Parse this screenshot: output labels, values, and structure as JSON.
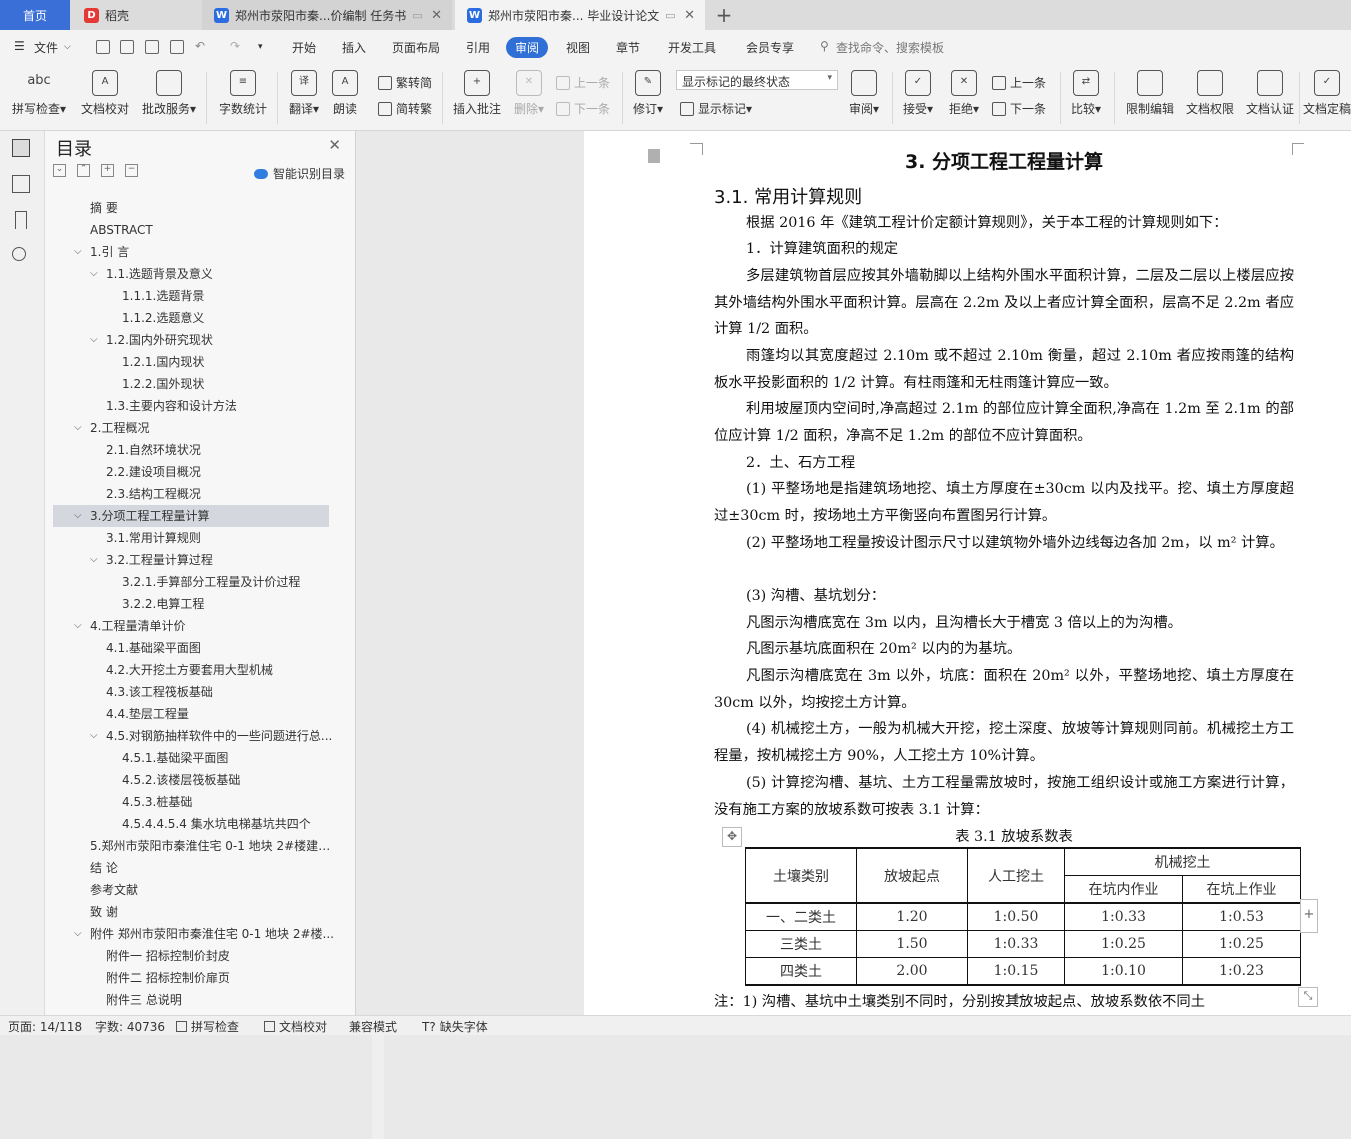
{
  "tabs": {
    "home": "首页",
    "daoke": "稻壳",
    "doc1": "郑州市荥阳市秦...价编制 任务书",
    "doc2": "郑州市荥阳市秦... 毕业设计论文"
  },
  "menu": {
    "file": "文件",
    "items": [
      "开始",
      "插入",
      "页面布局",
      "引用",
      "审阅",
      "视图",
      "章节",
      "开发工具",
      "会员专享"
    ],
    "search": "查找命令、搜索模板"
  },
  "ribbon": {
    "spell": "拼写检查",
    "proof": "文档校对",
    "annot_service": "批改服务",
    "wordcount": "字数统计",
    "translate": "翻译",
    "read": "朗读",
    "trad": "繁转简",
    "simp": "简转繁",
    "insert_comment": "插入批注",
    "delete": "删除",
    "prev_c": "上一条",
    "next_c": "下一条",
    "revise": "修订",
    "show_mode": "显示标记的最终状态",
    "show_marks": "显示标记",
    "review": "审阅",
    "accept": "接受",
    "reject": "拒绝",
    "prev": "上一条",
    "next": "下一条",
    "compare": "比较",
    "restrict": "限制编辑",
    "perm": "文档权限",
    "auth": "文档认证",
    "final": "文档定稿"
  },
  "toc": {
    "title": "目录",
    "smart": "智能识别目录",
    "items": [
      {
        "label": "摘  要",
        "level": 1,
        "chev": ""
      },
      {
        "label": "ABSTRACT",
        "level": 1,
        "chev": ""
      },
      {
        "label": "1.引  言",
        "level": 1,
        "chev": "v"
      },
      {
        "label": "1.1.选题背景及意义",
        "level": 2,
        "chev": "v"
      },
      {
        "label": "1.1.1.选题背景",
        "level": 3,
        "chev": ""
      },
      {
        "label": "1.1.2.选题意义",
        "level": 3,
        "chev": ""
      },
      {
        "label": "1.2.国内外研究现状",
        "level": 2,
        "chev": "v"
      },
      {
        "label": "1.2.1.国内现状",
        "level": 3,
        "chev": ""
      },
      {
        "label": "1.2.2.国外现状",
        "level": 3,
        "chev": ""
      },
      {
        "label": "1.3.主要内容和设计方法",
        "level": 2,
        "chev": ""
      },
      {
        "label": "2.工程概况",
        "level": 1,
        "chev": "v"
      },
      {
        "label": "2.1.自然环境状况",
        "level": 2,
        "chev": ""
      },
      {
        "label": "2.2.建设项目概况",
        "level": 2,
        "chev": ""
      },
      {
        "label": "2.3.结构工程概况",
        "level": 2,
        "chev": ""
      },
      {
        "label": "3.分项工程工程量计算",
        "level": 1,
        "chev": "v"
      },
      {
        "label": "3.1.常用计算规则",
        "level": 2,
        "chev": ""
      },
      {
        "label": "3.2.工程量计算过程",
        "level": 2,
        "chev": "v"
      },
      {
        "label": "3.2.1.手算部分工程量及计价过程",
        "level": 3,
        "chev": ""
      },
      {
        "label": "3.2.2.电算工程",
        "level": 3,
        "chev": ""
      },
      {
        "label": "4.工程量清单计价",
        "level": 1,
        "chev": "v"
      },
      {
        "label": "4.1.基础梁平面图",
        "level": 2,
        "chev": ""
      },
      {
        "label": "4.2.大开挖土方要套用大型机械",
        "level": 2,
        "chev": ""
      },
      {
        "label": "4.3.该工程筏板基础",
        "level": 2,
        "chev": ""
      },
      {
        "label": "4.4.垫层工程量",
        "level": 2,
        "chev": ""
      },
      {
        "label": "4.5.对钢筋抽样软件中的一些问题进行总...",
        "level": 2,
        "chev": "v"
      },
      {
        "label": "4.5.1.基础梁平面图",
        "level": 3,
        "chev": ""
      },
      {
        "label": "4.5.2.该楼层筏板基础",
        "level": 3,
        "chev": ""
      },
      {
        "label": "4.5.3.桩基础",
        "level": 3,
        "chev": ""
      },
      {
        "label": "4.5.4.4.5.4  集水坑电梯基坑共四个",
        "level": 3,
        "chev": ""
      },
      {
        "label": "5.郑州市荥阳市秦淮住宅 0-1 地块 2#楼建筑...",
        "level": 1,
        "chev": ""
      },
      {
        "label": "结  论",
        "level": 1,
        "chev": ""
      },
      {
        "label": "参考文献",
        "level": 1,
        "chev": ""
      },
      {
        "label": "致  谢",
        "level": 1,
        "chev": ""
      },
      {
        "label": "附件  郑州市荥阳市秦淮住宅 0-1 地块 2#楼...",
        "level": 1,
        "chev": "v"
      },
      {
        "label": "附件一  招标控制价封皮",
        "level": 2,
        "chev": ""
      },
      {
        "label": "附件二  招标控制价扉页",
        "level": 2,
        "chev": ""
      },
      {
        "label": "附件三  总说明",
        "level": 2,
        "chev": ""
      }
    ]
  },
  "doc": {
    "h1": "3. 分项工程工程量计算",
    "h2": "3.1. 常用计算规则",
    "p1": "根据 2016 年《建筑工程计价定额计算规则》，关于本工程的计算规则如下：",
    "p2": "1．计算建筑面积的规定",
    "p3": "多层建筑物首层应按其外墙勒脚以上结构外围水平面积计算，二层及二层以上楼层应按其外墙结构外围水平面积计算。层高在 2.2m 及以上者应计算全面积，层高不足 2.2m 者应计算 1/2 面积。",
    "p4": "雨篷均以其宽度超过 2.10m 或不超过 2.10m 衡量，超过 2.10m 者应按雨篷的结构板水平投影面积的 1/2 计算。有柱雨篷和无柱雨篷计算应一致。",
    "p5": "利用坡屋顶内空间时,净高超过 2.1m 的部位应计算全面积,净高在 1.2m 至 2.1m 的部位应计算 1/2 面积，净高不足 1.2m 的部位不应计算面积。",
    "p6": "2．土、石方工程",
    "p7": "(1) 平整场地是指建筑场地挖、填土方厚度在±30cm 以内及找平。挖、填土方厚度超过±30cm 时，按场地土方平衡竖向布置图另行计算。",
    "p8": "(2) 平整场地工程量按设计图示尺寸以建筑物外墙外边线每边各加 2m，以 m² 计算。",
    "p9": "(3) 沟槽、基坑划分：",
    "p10": "凡图示沟槽底宽在 3m 以内，且沟槽长大于槽宽 3 倍以上的为沟槽。",
    "p11": "凡图示基坑底面积在 20m² 以内的为基坑。",
    "p12": "凡图示沟槽底宽在 3m 以外，坑底：面积在 20m² 以外，平整场地挖、填土方厚度在 30cm 以外，均按挖土方计算。",
    "p13": "(4) 机械挖土方，一般为机械大开挖，挖土深度、放坡等计算规则同前。机械挖土方工程量，按机械挖土方 90%，人工挖土方 10%计算。",
    "p14": "(5) 计算挖沟槽、基坑、土方工程量需放坡时，按施工组织设计或施工方案进行计算，没有施工方案的放坡系数可按表 3.1 计算：",
    "caption": "表 3.1  放坡系数表",
    "table": {
      "h_soil": "土壤类别",
      "h_start": "放坡起点",
      "h_manual": "人工挖土",
      "h_mech": "机械挖土",
      "h_in": "在坑内作业",
      "h_on": "在坑上作业",
      "rows": [
        [
          "一、二类土",
          "1.20",
          "1:0.50",
          "1:0.33",
          "1:0.53"
        ],
        [
          "三类土",
          "1.50",
          "1:0.33",
          "1:0.25",
          "1:0.25"
        ],
        [
          "四类土",
          "2.00",
          "1:0.15",
          "1:0.10",
          "1:0.23"
        ]
      ]
    },
    "note": "注：1) 沟槽、基坑中土壤类别不同时，分别按其放坡起点、放坡系数依不同土"
  },
  "status": {
    "page": "页面: 14/118",
    "words": "字数: 40736",
    "spell": "拼写检查",
    "proof": "文档校对",
    "compat": "兼容模式",
    "missing_font": "缺失字体"
  }
}
